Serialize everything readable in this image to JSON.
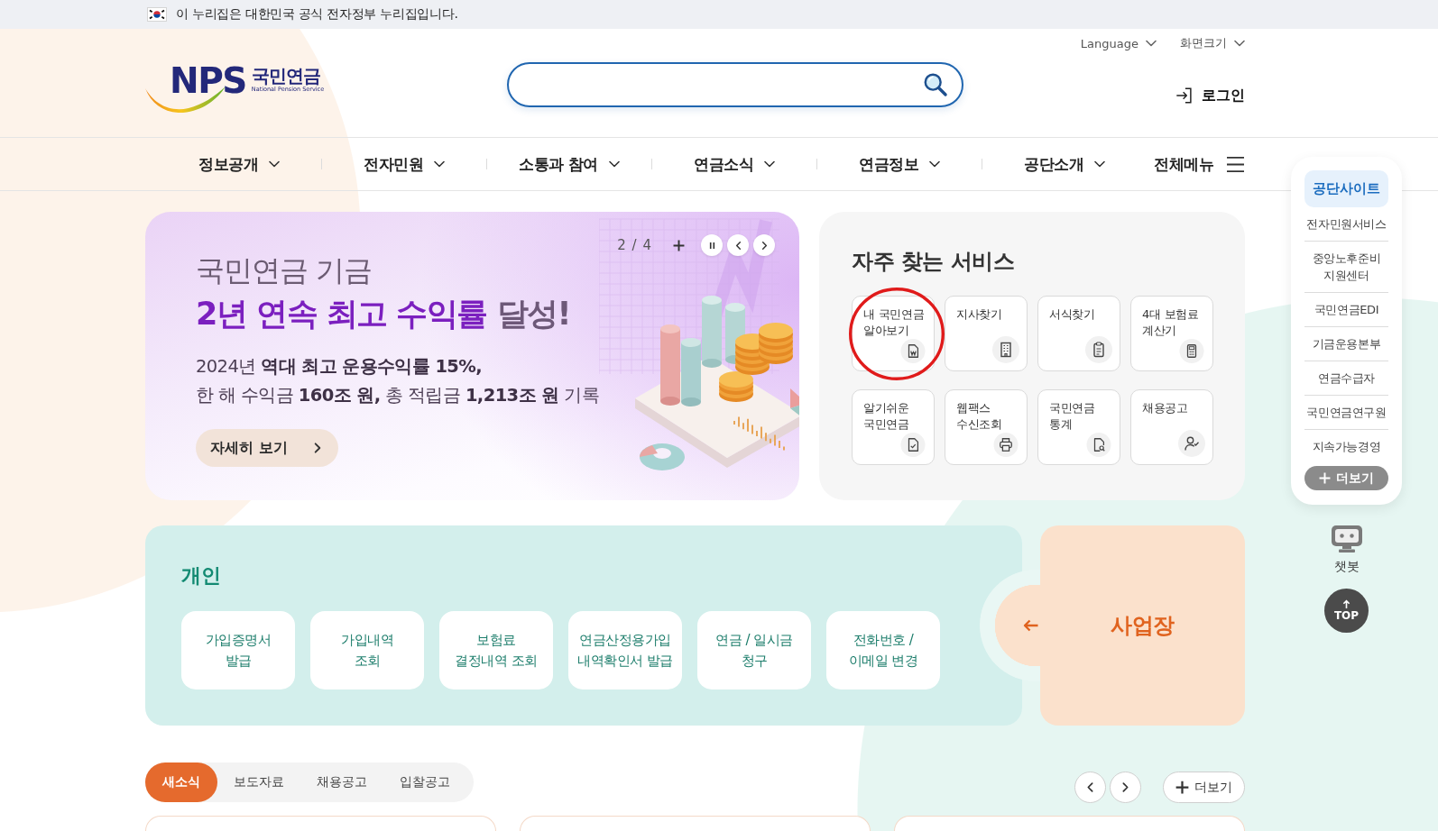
{
  "gov_banner": {
    "text": "이 누리집은 대한민국 공식 전자정부 누리집입니다."
  },
  "header": {
    "logo": {
      "mark": "NPS",
      "name": "국민연금",
      "tagline": "National Pension Service"
    },
    "utility_links": [
      {
        "label": "Language",
        "expanded": false
      },
      {
        "label": "화면크기",
        "expanded": false
      }
    ],
    "login": "로그인"
  },
  "nav": {
    "items": [
      {
        "label": "정보공개",
        "expanded": false
      },
      {
        "label": "전자민원",
        "expanded": false
      },
      {
        "label": "소통과 참여",
        "expanded": false
      },
      {
        "label": "연금소식",
        "expanded": false
      },
      {
        "label": "연금정보",
        "expanded": false
      },
      {
        "label": "공단소개",
        "expanded": false
      }
    ],
    "all_menu": "전체메뉴"
  },
  "banner": {
    "kicker": "국민연금 기금",
    "headline": "**2년 연속 최고 수익률** 달성!",
    "description": "2024년 **역대 최고 운용수익률 15%,**\n한 해 수익금 **160조 원,** 총 적립금 **1,213조 원** 기록",
    "button": "자세히 보기",
    "counter": "2 / 4",
    "paused": false
  },
  "services": {
    "title": "자주 찾는 서비스",
    "items": [
      {
        "label": "내 국민연금\n알아보기",
        "highlighted": true
      },
      {
        "label": "지사찾기",
        "highlighted": false
      },
      {
        "label": "서식찾기",
        "highlighted": false
      },
      {
        "label": "4대 보험료\n계산기",
        "highlighted": false
      },
      {
        "label": "알기쉬운\n국민연금",
        "highlighted": false
      },
      {
        "label": "웹팩스\n수신조회",
        "highlighted": false
      },
      {
        "label": "국민연금\n통계",
        "highlighted": false
      },
      {
        "label": "채용공고",
        "highlighted": false
      }
    ]
  },
  "quick_menu": {
    "title": "공단사이트",
    "items": [
      "전자민원서비스",
      "중앙노후준비\n지원센터",
      "국민연금EDI",
      "기금운용본부",
      "연금수급자",
      "국민연금연구원",
      "지속가능경영"
    ],
    "more": "더보기"
  },
  "chatbot": {
    "label": "챗봇"
  },
  "top_button": {
    "label": "TOP"
  },
  "personal": {
    "title": "개인",
    "items": [
      "가입증명서\n발급",
      "가입내역\n조회",
      "보험료\n결정내역 조회",
      "연금산정용가입\n내역확인서 발급",
      "연금 / 일시금\n청구",
      "전화번호 /\n이메일 변경"
    ]
  },
  "workplace": {
    "label": "사업장"
  },
  "news": {
    "tabs": [
      {
        "label": "새소식",
        "selected": true
      },
      {
        "label": "보도자료",
        "selected": false
      },
      {
        "label": "채용공고",
        "selected": false
      },
      {
        "label": "입찰공고",
        "selected": false
      }
    ],
    "more": "더보기"
  }
}
